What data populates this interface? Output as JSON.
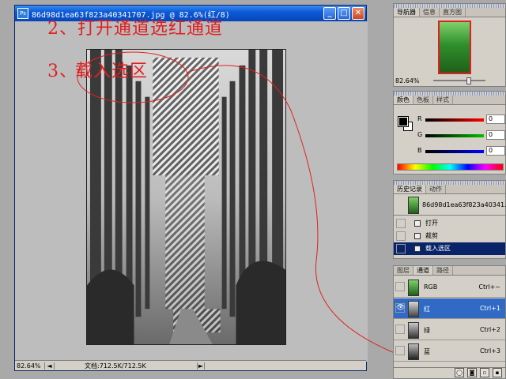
{
  "document": {
    "title": "86d98d1ea63f823a40341707.jpg @ 82.6%(红/8)",
    "app_icon": "Ps",
    "minimize": "_",
    "maximize": "□",
    "close": "✕",
    "status": {
      "zoom": "82.64%",
      "doc_size": "文档:712.5K/712.5K",
      "nav_icon": "◄",
      "arrow": "►"
    }
  },
  "annotations": {
    "step2": "2、打开通道选红通道",
    "step3_prefix": "3、",
    "step3_text": "载入选区"
  },
  "navigator": {
    "tabs": [
      "导航器",
      "信息",
      "直方图"
    ],
    "active_tab": 0,
    "zoom": "82.64%"
  },
  "color_panel": {
    "tabs": [
      "颜色",
      "色板",
      "样式"
    ],
    "active_tab": 0,
    "sliders": [
      {
        "label": "R",
        "value": "0",
        "color": "#ff0000"
      },
      {
        "label": "G",
        "value": "0",
        "color": "#00c000"
      },
      {
        "label": "B",
        "value": "0",
        "color": "#0000ff"
      }
    ]
  },
  "history": {
    "tabs": [
      "历史记录",
      "动作"
    ],
    "active_tab": 0,
    "snapshot": "86d98d1ea63f823a40341...",
    "items": [
      "打开",
      "裁剪",
      "载入选区"
    ],
    "active_item": 2
  },
  "channels": {
    "tabs": [
      "图层",
      "通道",
      "路径"
    ],
    "active_tab": 1,
    "rows": [
      {
        "name": "RGB",
        "shortcut": "Ctrl+~"
      },
      {
        "name": "红",
        "shortcut": "Ctrl+1"
      },
      {
        "name": "绿",
        "shortcut": "Ctrl+2"
      },
      {
        "name": "蓝",
        "shortcut": "Ctrl+3"
      }
    ],
    "active_row": 1,
    "eye_icon": "👁"
  },
  "colors": {
    "annotation": "#e02020",
    "selection_row": "#316ac5",
    "history_active": "#0a246a"
  }
}
